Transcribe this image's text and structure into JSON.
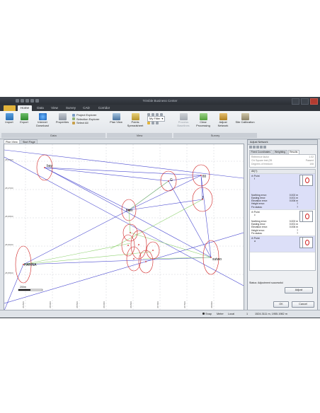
{
  "window": {
    "title": "Trimble Business Center"
  },
  "ribbon": {
    "tabs": [
      "Home",
      "Data",
      "View",
      "Survey",
      "CAD",
      "Corridor"
    ],
    "active_tab": "Home",
    "buttons": {
      "import": "Import",
      "export": "Export",
      "internet_download": "Internet Download",
      "properties": "Properties",
      "plan_view": "Plan View",
      "points_spreadsheet": "Points Spreadsheet",
      "process_baselines": "Process Baselines",
      "clear_processing": "Clear Processing",
      "adjust_network": "Adjust Network",
      "site_calibration": "Site Calibration"
    },
    "small_items": {
      "project_explorer": "Project Explorer",
      "selection_explorer": "Selection Explorer",
      "select_all": "Select All"
    },
    "filter": {
      "label": "My Filter"
    },
    "groups": {
      "data": "Data",
      "view": "View",
      "survey": "Survey"
    }
  },
  "doc_tabs": [
    "Plan View",
    "Start Page"
  ],
  "plan": {
    "labels": {
      "bay": "bay",
      "g": "G",
      "fill": "fill",
      "j": "J",
      "filter": "filter",
      "hanna": "HANNA",
      "sutwo": "sutwo",
      "scale": "200m"
    },
    "y_ticks": [
      "2817500",
      "2817000",
      "2816500",
      "2816000",
      "2815500"
    ],
    "x_ticks": [
      "354500",
      "355000",
      "355500",
      "356000",
      "356500",
      "357000",
      "357500",
      "358000"
    ]
  },
  "panel": {
    "title": "Adjust Network",
    "tabs": [
      "Fixed Coordinates",
      "Weighting",
      "Results"
    ],
    "active_tab": "Results",
    "props": [
      {
        "label": "Reference factor",
        "value": "1.02"
      },
      {
        "label": "Chi Square test (95",
        "value": "Passed"
      },
      {
        "label": "Degrees of freedom",
        "value": "108"
      }
    ],
    "list_header": "All(?)",
    "entries": [
      {
        "name": "Point",
        "code": "f",
        "northing": "0.002 m",
        "easting": "0.001 m",
        "elevation": "0.006 m",
        "height": "?",
        "fix": "?"
      },
      {
        "name": "Point",
        "code": "c",
        "northing": "0.002 m",
        "easting": "0.001 m",
        "elevation": "0.006 m",
        "height": "?",
        "fix": "?"
      },
      {
        "name": "Point",
        "code": "a",
        "northing": "",
        "easting": "",
        "elevation": "",
        "height": "",
        "fix": ""
      }
    ],
    "labels": {
      "northing": "Northing error:",
      "easting": "Easting error:",
      "elevation": "Elevation error:",
      "height": "Height error:",
      "fix": "Fix status:"
    },
    "status": "Status: Adjustment successful",
    "adjust_button": "Adjust",
    "ok_button": "OK",
    "cancel_button": "Cancel"
  },
  "statusbar": {
    "snap": "Snap",
    "units": "Meter",
    "coord_sys": "Local",
    "page": "1",
    "coords": "1524.3111 m, 1955.1982 m"
  }
}
